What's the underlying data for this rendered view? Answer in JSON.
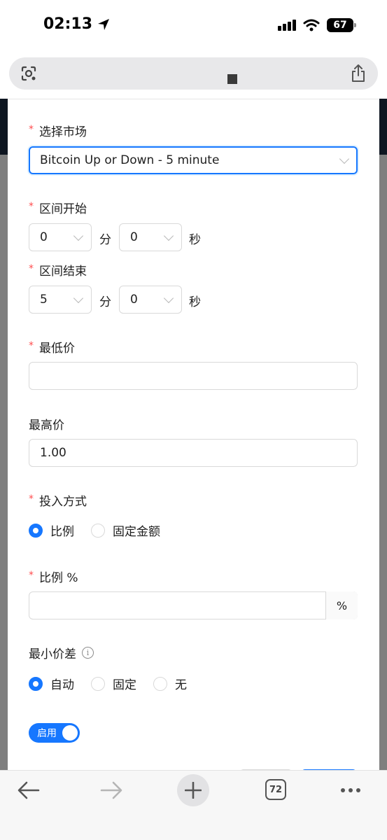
{
  "status_bar": {
    "time": "02:13",
    "battery": "67"
  },
  "browser": {
    "tab_count": "72"
  },
  "form": {
    "market": {
      "label": "选择市场",
      "value": "Bitcoin Up or Down - 5 minute"
    },
    "range_start": {
      "label": "区间开始",
      "minutes": "0",
      "minute_unit": "分",
      "seconds": "0",
      "second_unit": "秒"
    },
    "range_end": {
      "label": "区间结束",
      "minutes": "5",
      "minute_unit": "分",
      "seconds": "0",
      "second_unit": "秒"
    },
    "min_price": {
      "label": "最低价",
      "value": ""
    },
    "max_price": {
      "label": "最高价",
      "value": "1.00"
    },
    "invest_mode": {
      "label": "投入方式",
      "options": [
        "比例",
        "固定金额"
      ],
      "selected": "比例"
    },
    "ratio": {
      "label": "比例 %",
      "value": "",
      "addon": "%"
    },
    "min_spread": {
      "label": "最小价差",
      "options": [
        "自动",
        "固定",
        "无"
      ],
      "selected": "自动"
    },
    "enable_switch": {
      "label": "启用",
      "on": true
    }
  },
  "colors": {
    "primary": "#1677ff",
    "required": "#ff4d4f",
    "border": "#d9d9d9"
  }
}
